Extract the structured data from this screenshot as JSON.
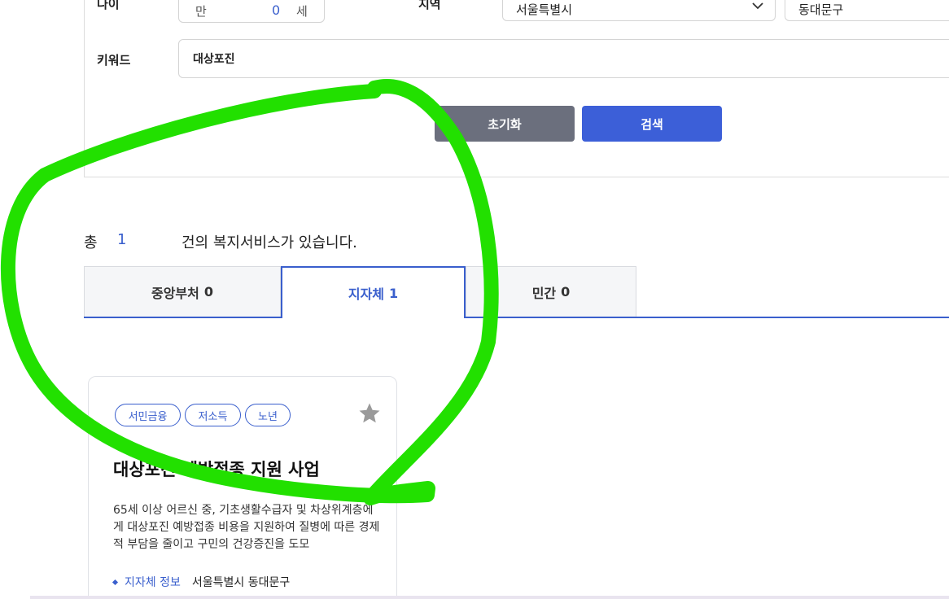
{
  "filters": {
    "age_label": "나이",
    "age_unit_prefix": "만",
    "age_value": "0",
    "age_unit_suffix": "세",
    "region_label": "지역",
    "region_value": "서울특별시",
    "district_value": "동대문구",
    "keyword_label": "키워드",
    "keyword_value": "대상포진",
    "reset_label": "초기화",
    "search_label": "검색"
  },
  "summary": {
    "prefix": "총",
    "count": "1",
    "suffix": "건의 복지서비스가 있습니다."
  },
  "tabs": [
    {
      "label": "중앙부처",
      "count": "0",
      "active": false
    },
    {
      "label": "지자체",
      "count": "1",
      "active": true
    },
    {
      "label": "민간",
      "count": "0",
      "active": false
    }
  ],
  "card": {
    "tags": [
      "서민금융",
      "저소득",
      "노년"
    ],
    "title": "대상포진 예방접종 지원 사업",
    "description": "65세 이상 어르신 중, 기초생활수급자 및 차상위계층에게 대상포진 예방접종 비용을 지원하여 질병에 따른 경제적 부담을 줄이고 구민의 건강증진을 도모",
    "info_label": "지자체 정보",
    "info_value": "서울특별시 동대문구"
  },
  "colors": {
    "accent": "#3a5fcd",
    "reset_button": "#6b6f7d",
    "search_button": "#3c5fd8",
    "highlight": "#22e000"
  },
  "icons": {
    "favorite": "star-icon",
    "dropdown": "chevron-down-icon"
  }
}
